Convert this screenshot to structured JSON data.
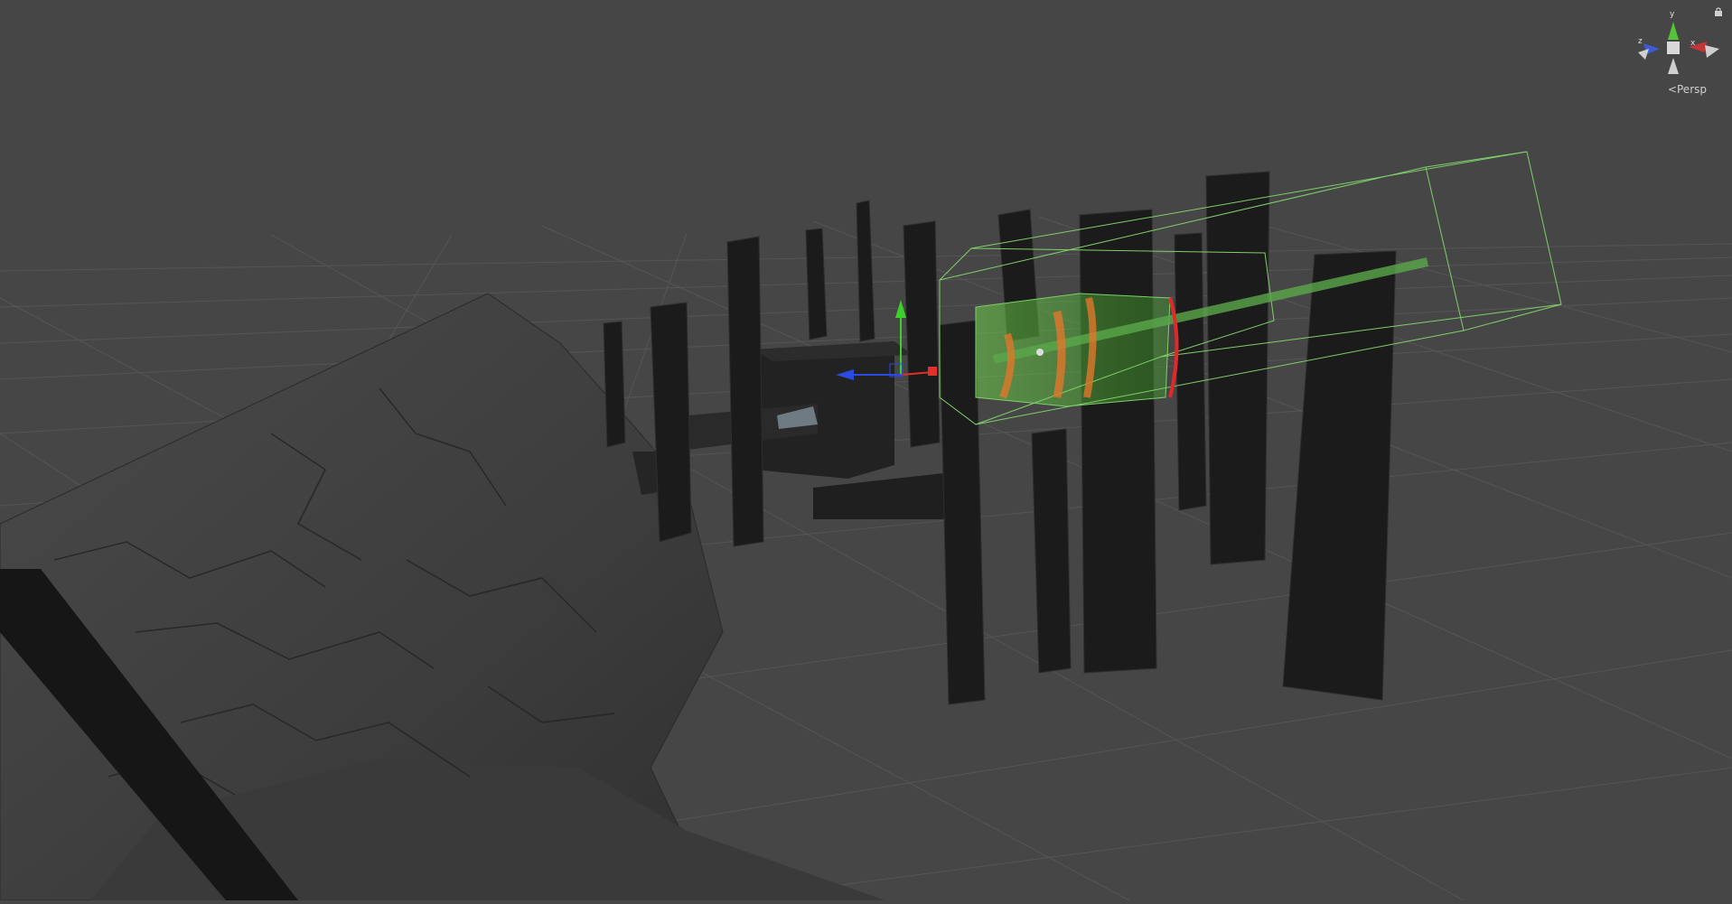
{
  "scene_view": {
    "projection_label": "Persp",
    "axis_labels": {
      "x": "x",
      "y": "y",
      "z": "z"
    }
  },
  "colors": {
    "background": "#464646",
    "grid": "#5a5a5a",
    "rock": "#3a3a3a",
    "pillar": "#1c1c1c",
    "selection_volume": "#7fcf6a",
    "particles": "#e0772a",
    "axis_x": "#e0302a",
    "axis_y": "#3cd02a",
    "axis_z": "#2a4ae0"
  },
  "icons": {
    "orientation_gizmo": "view-gizmo-icon",
    "lock": "lock-icon",
    "persp_toggle": "persp-arrow-icon"
  }
}
